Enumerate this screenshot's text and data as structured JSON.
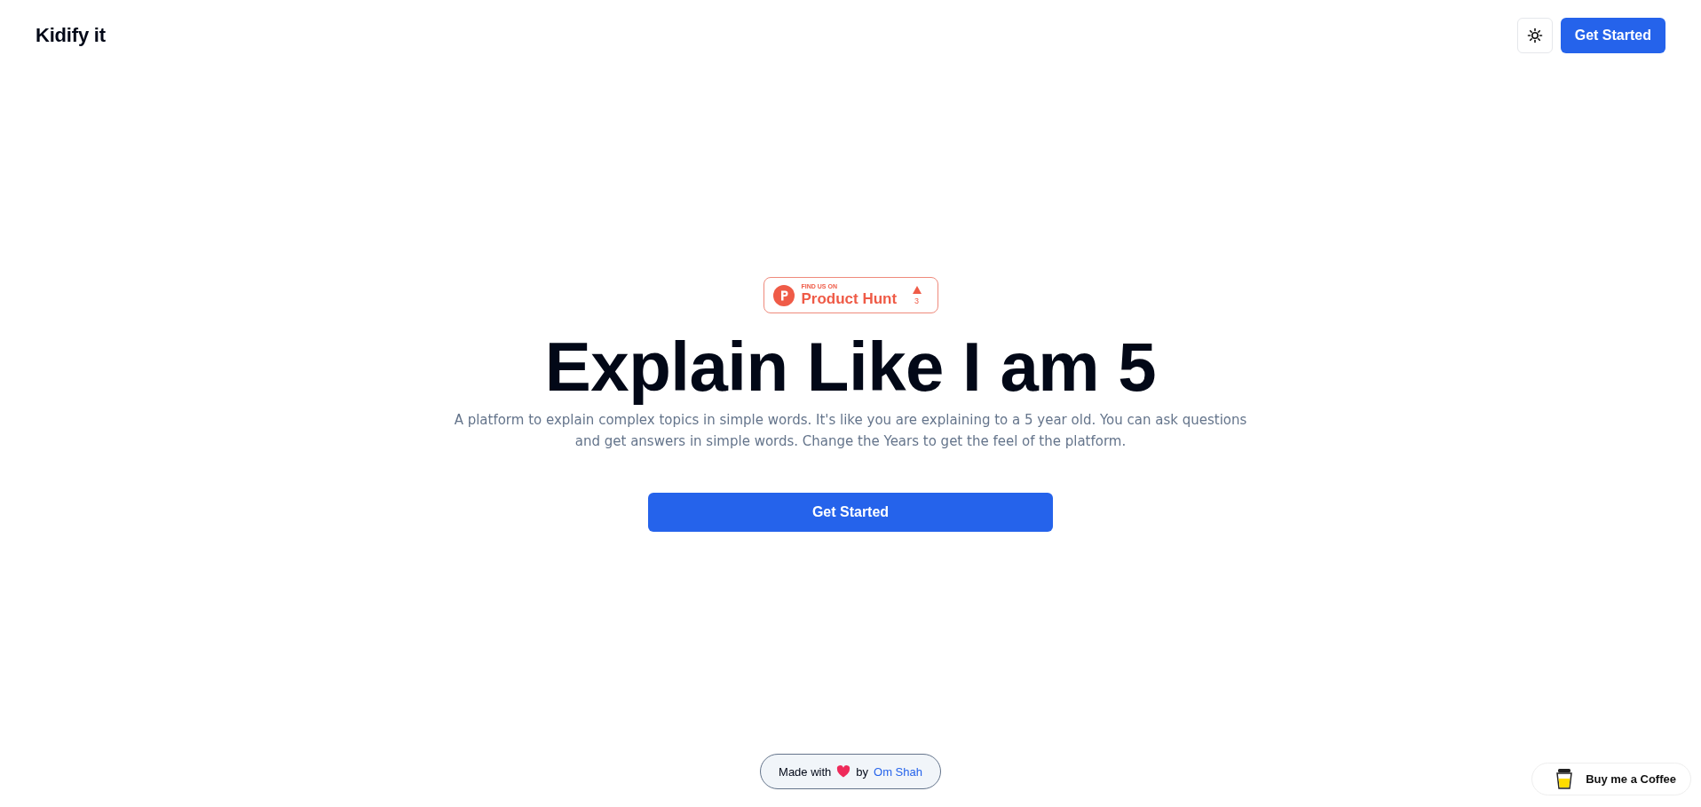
{
  "header": {
    "logo": "Kidify it",
    "theme_toggle": {
      "dark": false
    },
    "cta": "Get Started"
  },
  "badge": {
    "kicker": "FIND US ON",
    "name": "Product Hunt",
    "votes": "3"
  },
  "hero": {
    "title": "Explain Like I am 5",
    "description": "A platform to explain complex topics in simple words. It's like you are explaining to a 5 year old. You can ask questions and get answers in simple words. Change the Years to get the feel of the platform.",
    "button": "Get Started"
  },
  "footer": {
    "prefix": "Made with",
    "middle": "by",
    "author": "Om Shah"
  },
  "coffee_button": "Buy me a Coffee"
}
